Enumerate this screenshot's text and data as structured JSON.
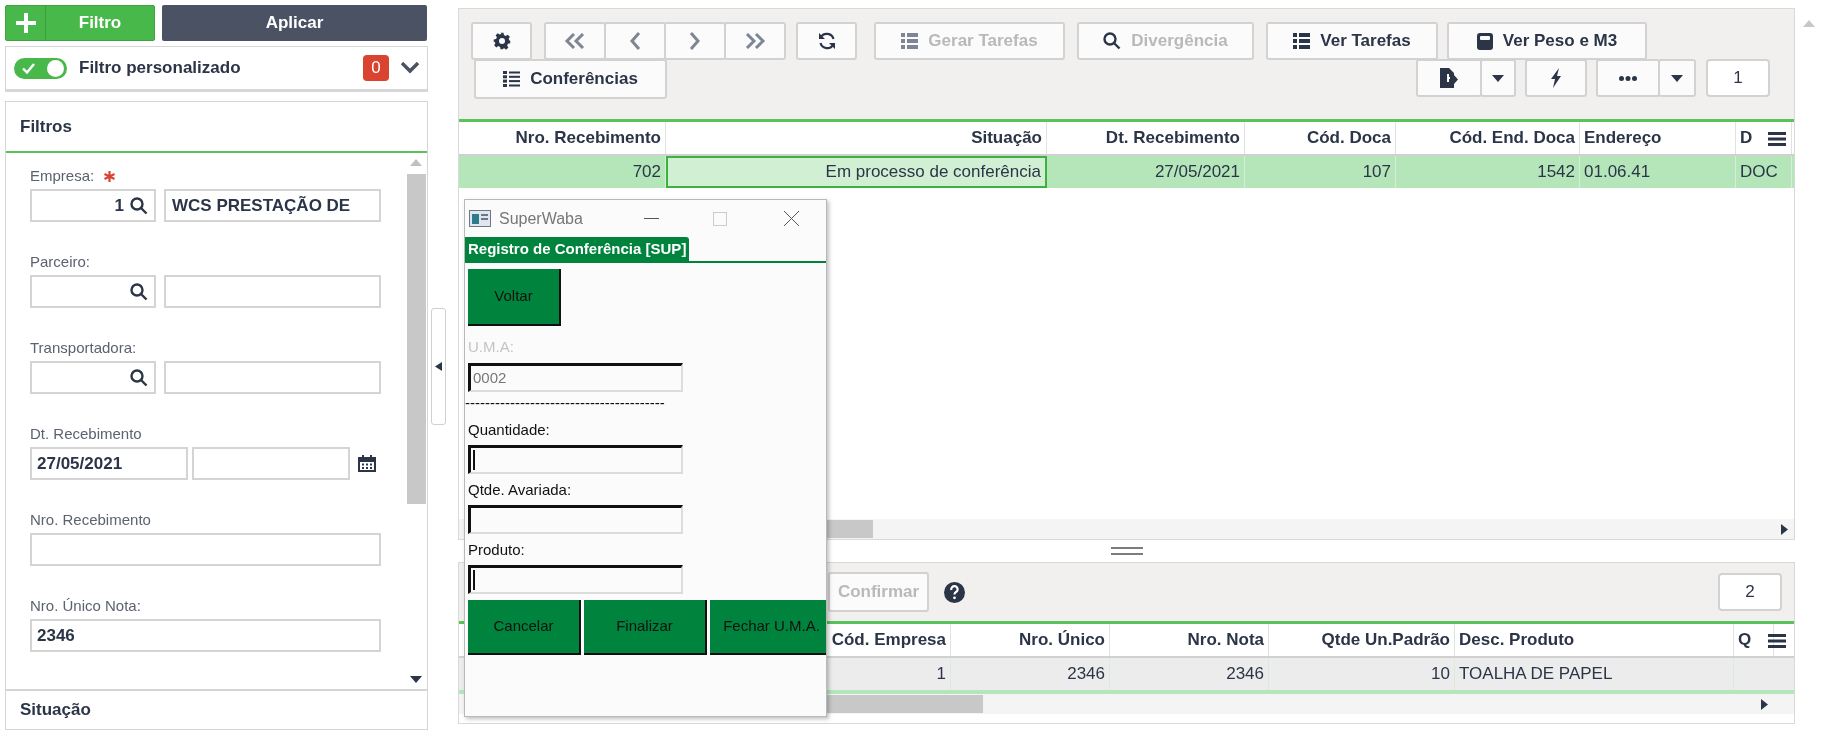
{
  "left_panel": {
    "add_filter_button": "Filtro",
    "apply_button": "Aplicar",
    "custom_filter": {
      "label": "Filtro personalizado",
      "on": true,
      "count": "0",
      "expanded": false
    },
    "filters": {
      "title": "Filtros",
      "fields": [
        {
          "label": "Empresa:",
          "required": true,
          "kind": "lookup",
          "code": "1",
          "description": "WCS PRESTAÇÃO DE"
        },
        {
          "label": "Parceiro:",
          "required": false,
          "kind": "lookup"
        },
        {
          "label": "Transportadora:",
          "required": false,
          "kind": "lookup"
        },
        {
          "label": "Dt. Recebimento",
          "required": false,
          "kind": "date_range",
          "from": "27/05/2021"
        },
        {
          "label": "Nro. Recebimento",
          "required": false,
          "kind": "text"
        },
        {
          "label": "Nro. Único Nota:",
          "required": false,
          "kind": "text",
          "value": "2346"
        }
      ]
    },
    "situation_section": "Situação"
  },
  "top_toolbar": {
    "buttons": [
      {
        "label": "Gerar Tarefas",
        "disabled": true
      },
      {
        "label": "Divergência",
        "disabled": true
      },
      {
        "label": "Ver Tarefas",
        "disabled": false
      },
      {
        "label": "Ver Peso e M3",
        "disabled": false
      },
      {
        "label": "Conferências",
        "disabled": false
      }
    ],
    "page_badge": "1"
  },
  "top_grid": {
    "columns": [
      {
        "label": "Nro. Recebimento",
        "kind": "number"
      },
      {
        "label": "Situação",
        "kind": "number"
      },
      {
        "label": "Dt. Recebimento",
        "kind": "number"
      },
      {
        "label": "Cód. Doca",
        "kind": "number"
      },
      {
        "label": "Cód. End. Doca",
        "kind": "number"
      },
      {
        "label": "Endereço",
        "kind": "text"
      },
      {
        "label": "D",
        "kind": "text"
      }
    ],
    "rows": [
      {
        "selected": true,
        "cells": [
          {
            "text": "702",
            "focused": false
          },
          {
            "text": "Em processo de conferência",
            "focused": true
          },
          {
            "text": "27/05/2021",
            "focused": false
          },
          {
            "text": "107",
            "focused": false
          },
          {
            "text": "1542",
            "focused": false
          },
          {
            "text": "01.06.41",
            "focused": false
          },
          {
            "text": "DOC",
            "focused": false
          }
        ]
      }
    ]
  },
  "dialog": {
    "title": "SuperWaba",
    "tab": "Registro de Conferência [SUP]",
    "back_button": "Voltar",
    "uma": {
      "label": "U.M.A:",
      "value": "0002",
      "disabled": true
    },
    "separator": "----------------------------------------",
    "fields": [
      {
        "label": "Quantidade:",
        "cursor": true
      },
      {
        "label": "Qtde. Avariada:",
        "cursor": false
      },
      {
        "label": "Produto:",
        "cursor": true
      }
    ],
    "buttons": [
      "Cancelar",
      "Finalizar",
      "Fechar U.M.A."
    ]
  },
  "bottom_toolbar": {
    "confirm_button": {
      "label": "Confirmar",
      "disabled": true
    },
    "page_badge": "2"
  },
  "bottom_grid": {
    "columns": [
      {
        "label": "Cód. Empresa",
        "kind": "number"
      },
      {
        "label": "Nro. Único",
        "kind": "number"
      },
      {
        "label": "Nro. Nota",
        "kind": "number"
      },
      {
        "label": "Qtde Un.Padrão",
        "kind": "number"
      },
      {
        "label": "Desc. Produto",
        "kind": "text"
      },
      {
        "label": "Q",
        "kind": "text"
      }
    ],
    "rows": [
      {
        "selected": false,
        "cells": [
          "1",
          "2346",
          "2346",
          "10",
          "TOALHA DE PAPEL"
        ]
      }
    ]
  }
}
